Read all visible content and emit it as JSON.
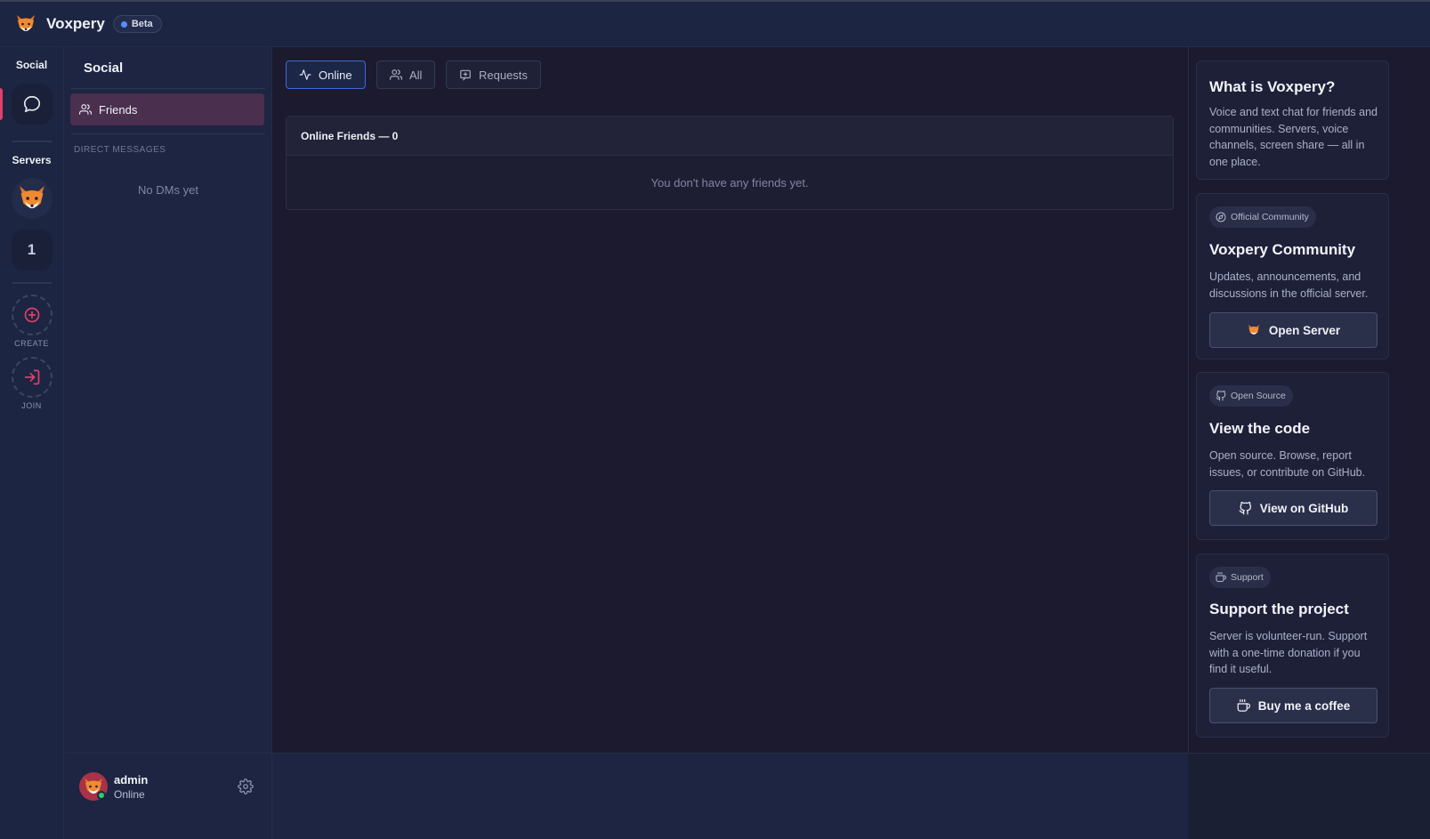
{
  "topbar": {
    "brand_name": "Voxpery",
    "beta_label": "Beta",
    "logo_icon": "fox-logo-icon"
  },
  "rail": {
    "social_heading": "Social",
    "servers_heading": "Servers",
    "server_number": "1",
    "create_label": "CREATE",
    "join_label": "JOIN",
    "accent_color": "#e0406a"
  },
  "social": {
    "title": "Social",
    "friends_label": "Friends",
    "dm_heading": "DIRECT MESSAGES",
    "no_dms": "No DMs yet"
  },
  "user": {
    "name": "admin",
    "status": "Online",
    "status_color": "#2ecc71"
  },
  "main": {
    "tabs": [
      {
        "label": "Online",
        "icon": "activity-icon",
        "active": true
      },
      {
        "label": "All",
        "icon": "users-icon",
        "active": false
      },
      {
        "label": "Requests",
        "icon": "message-plus-icon",
        "active": false
      }
    ],
    "panel_title": "Online Friends — 0",
    "empty_text": "You don't have any friends yet."
  },
  "right": {
    "about": {
      "title": "What is Voxpery?",
      "text": "Voice and text chat for friends and communities. Servers, voice channels, screen share — all in one place."
    },
    "community": {
      "chip": "Official Community",
      "title": "Voxpery Community",
      "text": "Updates, announcements, and discussions in the official server.",
      "button": "Open Server"
    },
    "opensource": {
      "chip": "Open Source",
      "title": "View the code",
      "text": "Open source. Browse, report issues, or contribute on GitHub.",
      "button": "View on GitHub"
    },
    "support": {
      "chip": "Support",
      "title": "Support the project",
      "text": "Server is volunteer-run. Support with a one-time donation if you find it useful.",
      "button": "Buy me a coffee"
    }
  }
}
